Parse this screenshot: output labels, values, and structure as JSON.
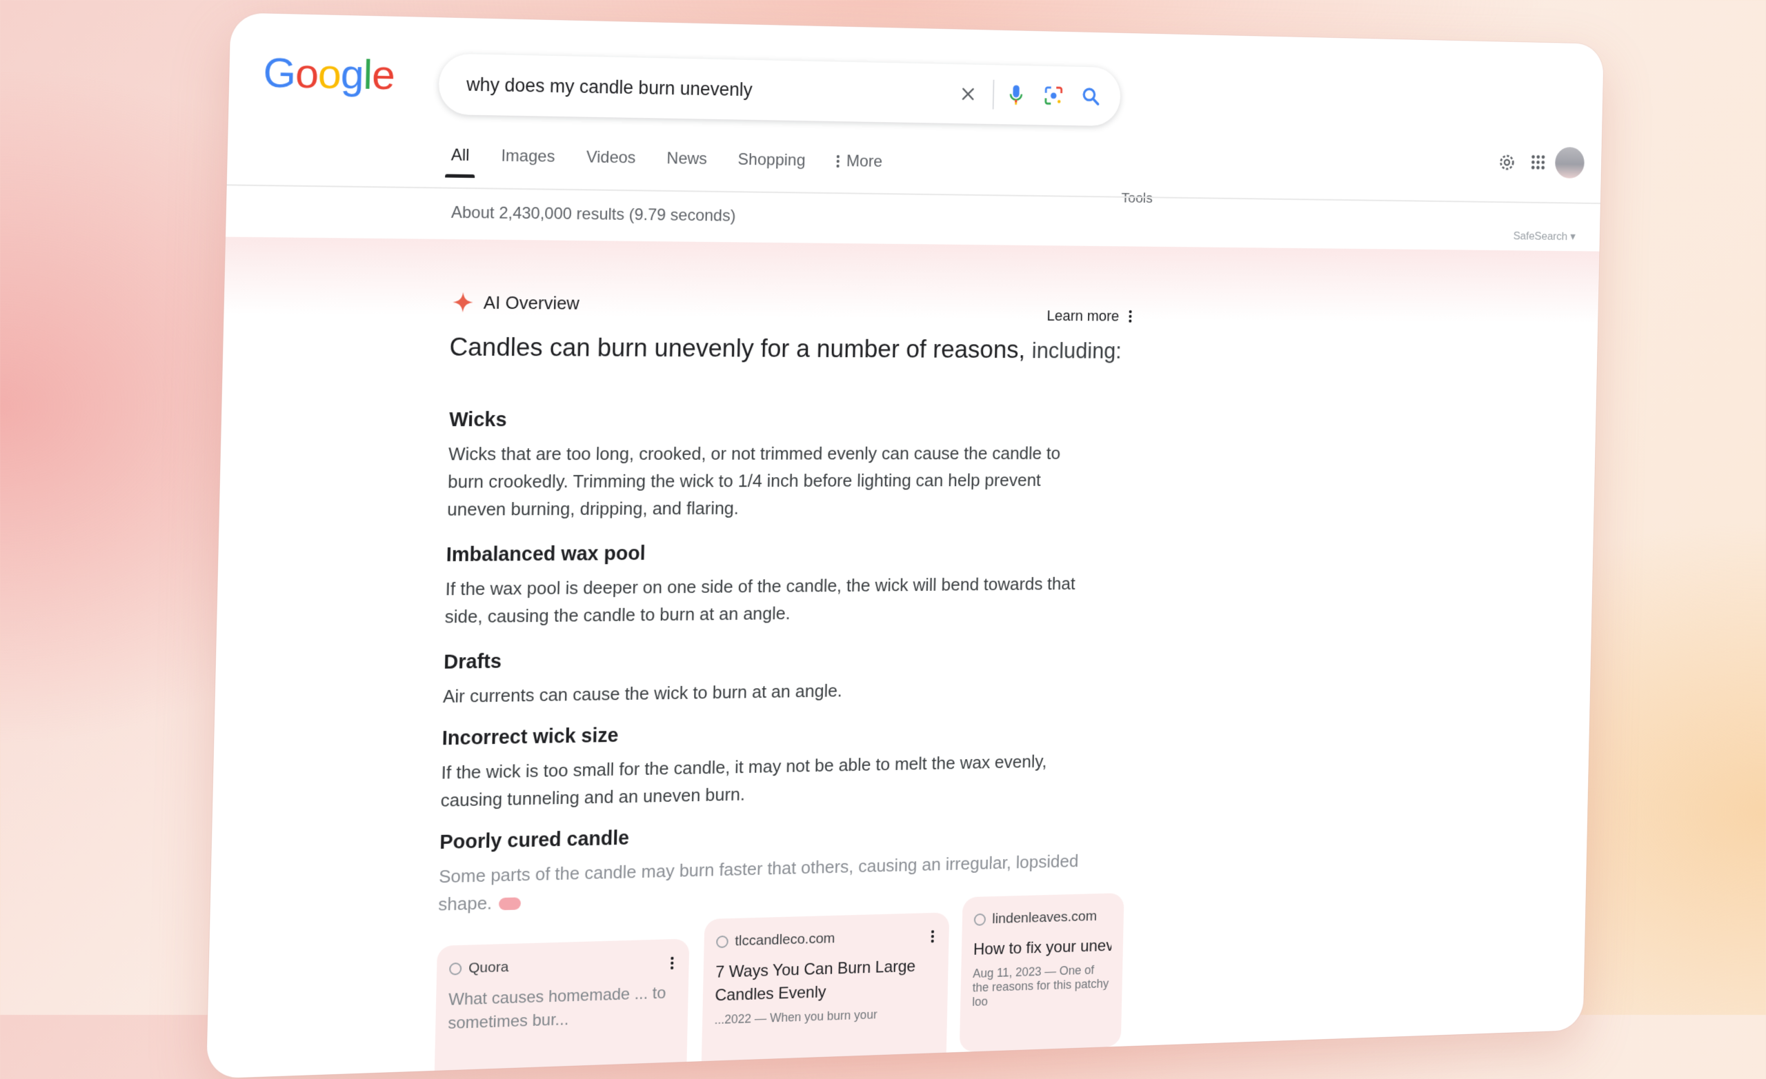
{
  "header": {
    "logo": "Google",
    "query": "why does my candle burn unevenly",
    "tabs": [
      "All",
      "Images",
      "Videos",
      "News",
      "Shopping",
      "More"
    ],
    "tools": "Tools",
    "result_stats": "About 2,430,000 results (9.79 seconds)",
    "safesearch": "SafeSearch"
  },
  "ai_overview": {
    "label": "AI Overview",
    "learn_more": "Learn more",
    "headline": "Candles can burn unevenly for a number of reasons,",
    "headline_sub": "including:",
    "sections": [
      {
        "title": "Wicks",
        "text": "Wicks that are too long, crooked, or not trimmed evenly can cause the candle to burn crookedly. Trimming the wick to 1/4 inch before lighting can help prevent uneven burning, dripping, and flaring."
      },
      {
        "title": "Imbalanced wax pool",
        "text": "If the wax pool is deeper on one side of the candle, the wick will bend towards that side, causing the candle to burn at an angle."
      },
      {
        "title": "Drafts",
        "text": "Air currents can cause the wick to burn at an angle."
      },
      {
        "title": "Incorrect wick size",
        "text": "If the wick is too small for the candle, it may not be able to melt the wax evenly, causing tunneling and an uneven burn."
      },
      {
        "title": "Poorly cured candle",
        "text": "Some parts of the candle may burn faster that others, causing an irregular, lopsided shape."
      }
    ]
  },
  "sources": [
    {
      "site": "Quora",
      "title": "What causes homemade ... to sometimes bur...",
      "snippet": ""
    },
    {
      "site": "tlccandleco.com",
      "title": "7 Ways You Can Burn Large Candles Evenly",
      "snippet": "...2022 — When you burn your"
    },
    {
      "site": "lindenleaves.com",
      "title": "How to fix your unever why you should choos",
      "snippet": "Aug 11, 2023 — One of the reasons for this patchy loo"
    }
  ],
  "colors": {
    "accent": "#EA4335",
    "ai_star": "#E8604C",
    "blue": "#4285F4"
  }
}
